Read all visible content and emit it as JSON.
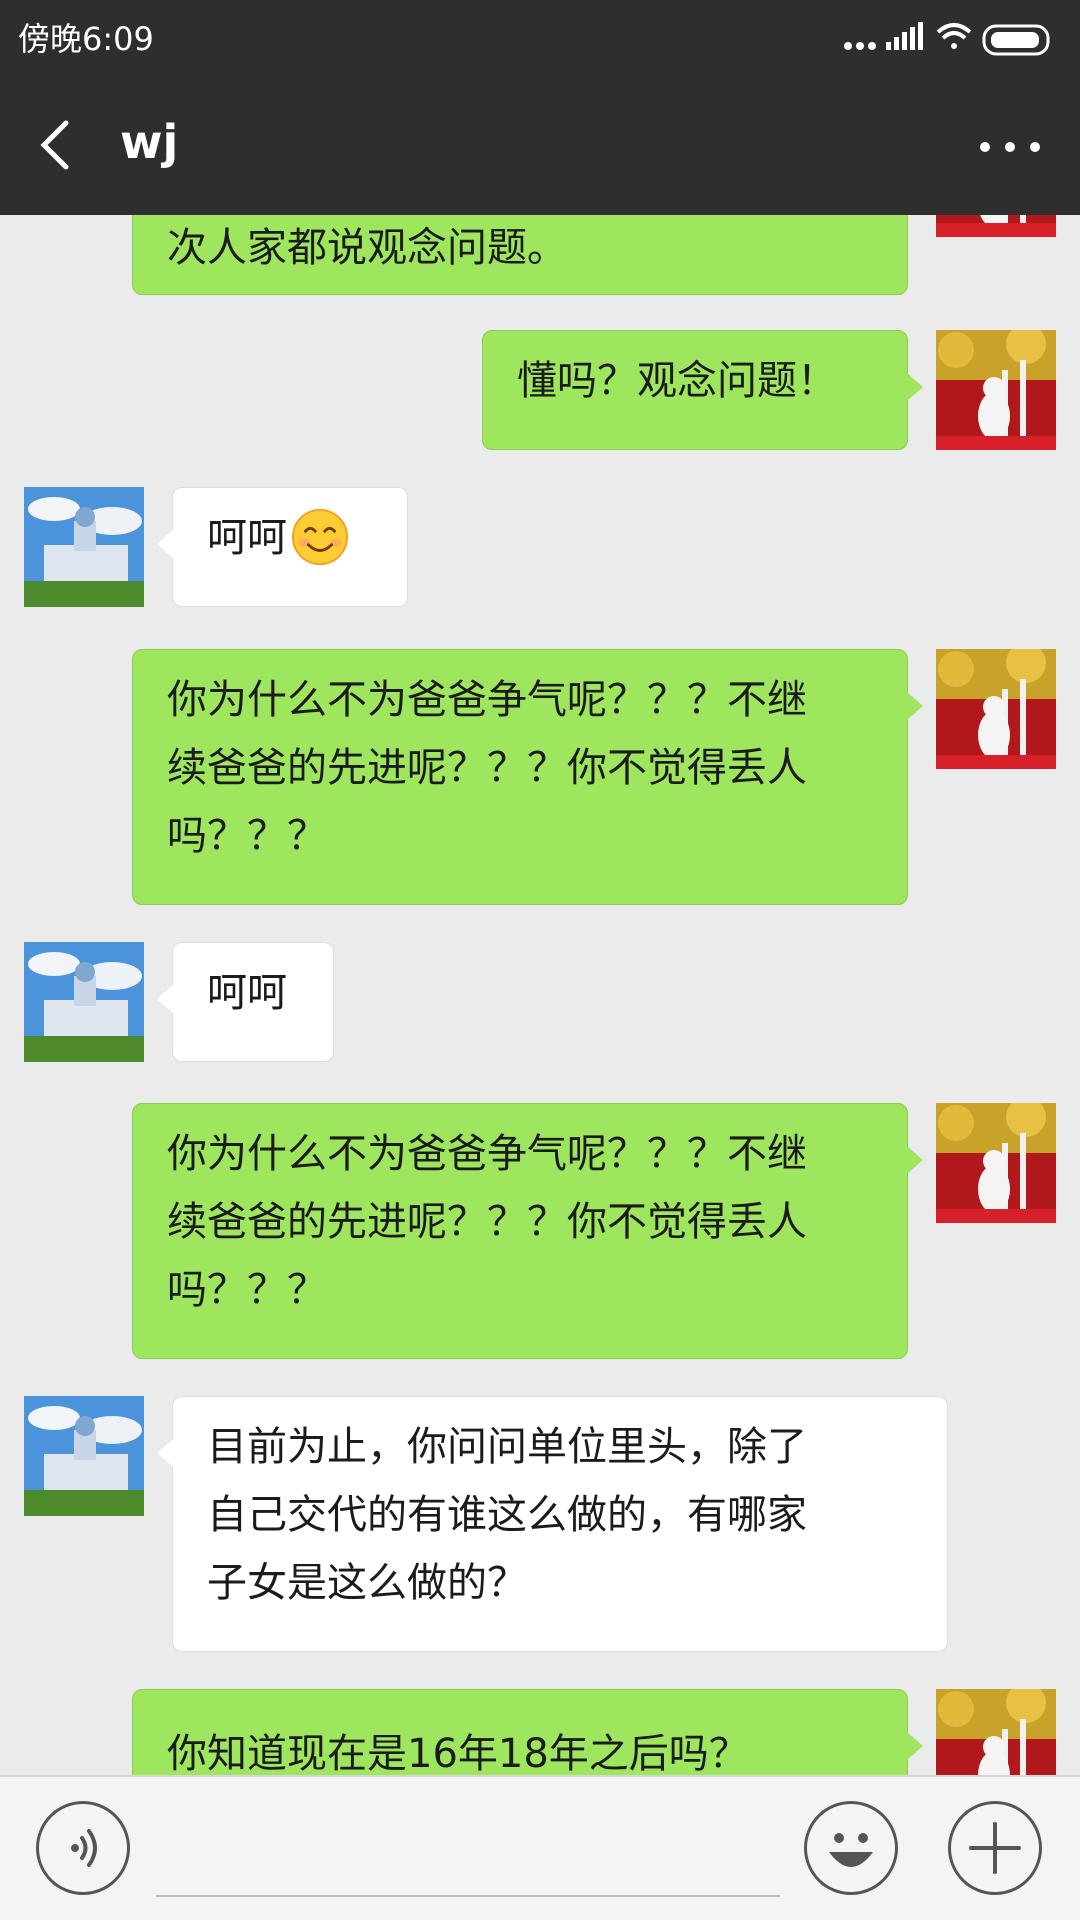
{
  "status_bar": {
    "time": "傍晚6:09"
  },
  "nav": {
    "title": "wj"
  },
  "icons": {
    "back": "chevron-left-icon",
    "more": "more-dots-icon",
    "voice": "voice-icon",
    "emoji": "smiley-icon",
    "plus": "plus-icon"
  },
  "colors": {
    "header": "#2e2e2e",
    "mine_bubble": "#9fe65f",
    "theirs_bubble": "#ffffff",
    "background": "#ebebeb"
  },
  "messages": [
    {
      "sender": "me",
      "lines": [
        "次人家都说观念问题。"
      ]
    },
    {
      "sender": "me",
      "lines": [
        "懂吗？观念问题！"
      ]
    },
    {
      "sender": "them",
      "lines": [
        "呵呵"
      ],
      "emoji": "smiling-face-icon"
    },
    {
      "sender": "me",
      "lines": [
        "你为什么不为爸爸争气呢？？？不继",
        "续爸爸的先进呢？？？你不觉得丢人",
        "吗？？？"
      ]
    },
    {
      "sender": "them",
      "lines": [
        "呵呵"
      ]
    },
    {
      "sender": "me",
      "lines": [
        "你为什么不为爸爸争气呢？？？不继",
        "续爸爸的先进呢？？？你不觉得丢人",
        "吗？？？"
      ]
    },
    {
      "sender": "them",
      "lines": [
        "目前为止，你问问单位里头，除了",
        "自己交代的有谁这么做的，有哪家",
        "子女是这么做的？"
      ]
    },
    {
      "sender": "me",
      "lines": [
        "你知道现在是16年18年之后吗？"
      ]
    }
  ]
}
